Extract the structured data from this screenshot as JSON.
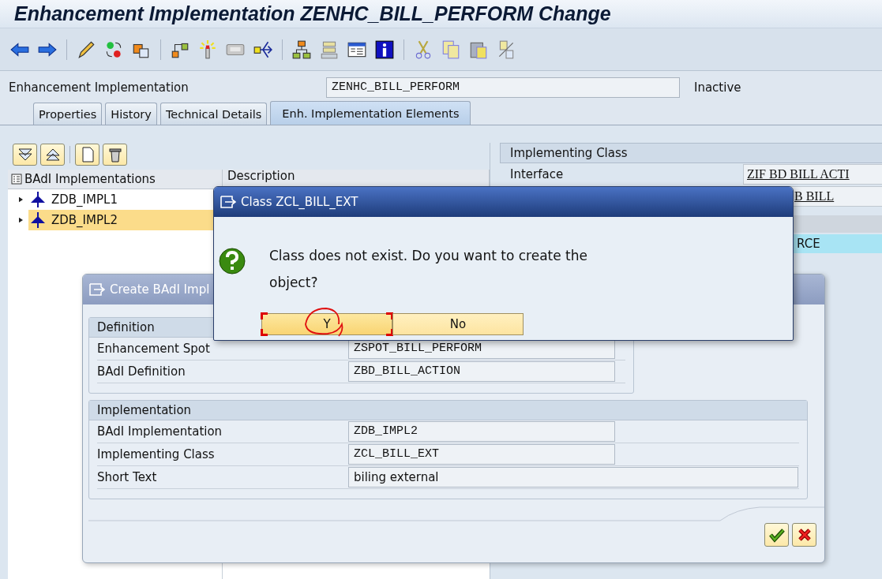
{
  "window": {
    "title": "Enhancement Implementation ZENHC_BILL_PERFORM Change"
  },
  "header": {
    "label": "Enhancement Implementation",
    "value": "ZENHC_BILL_PERFORM",
    "status": "Inactive"
  },
  "tabs": [
    {
      "label": "Properties",
      "selected": false
    },
    {
      "label": "History",
      "selected": false
    },
    {
      "label": "Technical Details",
      "selected": false
    },
    {
      "label": "Enh. Implementation Elements",
      "selected": true
    }
  ],
  "tree": {
    "columns": [
      "BAdI Implementations",
      "Description"
    ],
    "rows": [
      {
        "label": "ZDB_IMPL1",
        "selected": false
      },
      {
        "label": "ZDB_IMPL2",
        "selected": true
      }
    ]
  },
  "implementing_class": {
    "title": "Implementing Class",
    "rows": [
      {
        "label": "Interface",
        "value": "ZIF BD BILL ACTI"
      },
      {
        "value": "B BILL"
      }
    ],
    "highlight_row": "RCE"
  },
  "create_dialog": {
    "title": "Create BAdI Impl",
    "groups": [
      {
        "title": "Definition",
        "rows": [
          {
            "label": "Enhancement Spot",
            "value": "ZSPOT_BILL_PERFORM",
            "kind": "code"
          },
          {
            "label": "BAdI Definition",
            "value": "ZBD_BILL_ACTION",
            "kind": "code"
          }
        ]
      },
      {
        "title": "Implementation",
        "rows": [
          {
            "label": "BAdI Implementation",
            "value": "ZDB_IMPL2",
            "kind": "code"
          },
          {
            "label": "Implementing Class",
            "value": "ZCL_BILL_EXT",
            "kind": "code"
          },
          {
            "label": "Short Text",
            "value": "biling external",
            "kind": "text"
          }
        ]
      }
    ]
  },
  "confirm_dialog": {
    "title": "Class ZCL_BILL_EXT",
    "message": "Class does not exist. Do you want to create the object?",
    "buttons": [
      {
        "label": "Y",
        "focused": true
      },
      {
        "label": "No",
        "focused": false
      }
    ]
  }
}
